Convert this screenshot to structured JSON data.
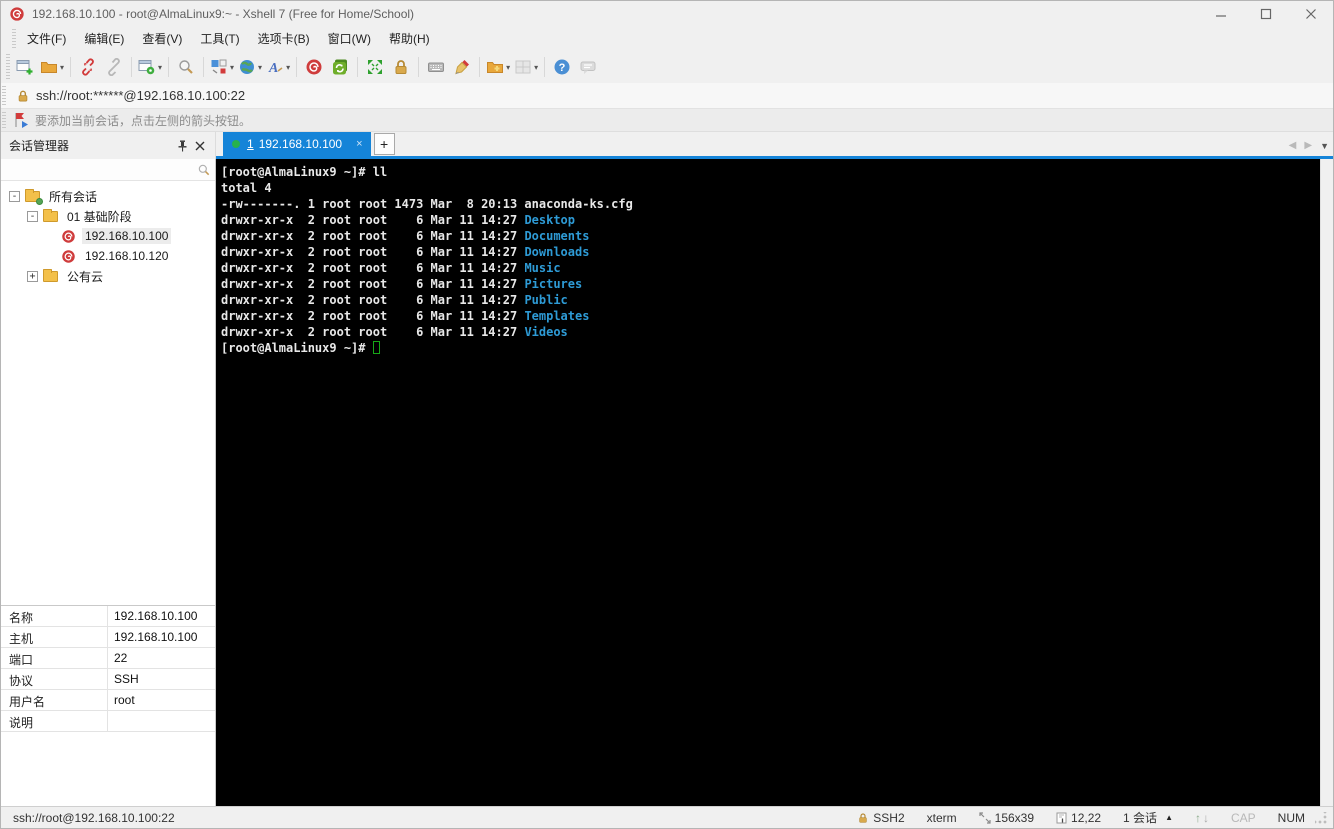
{
  "window": {
    "title": "192.168.10.100 - root@AlmaLinux9:~ - Xshell 7 (Free for Home/School)",
    "controls": {
      "minimize": "–",
      "maximize": "□",
      "close": "×"
    }
  },
  "menu": {
    "items": [
      "文件(F)",
      "编辑(E)",
      "查看(V)",
      "工具(T)",
      "选项卡(B)",
      "窗口(W)",
      "帮助(H)"
    ]
  },
  "toolbar": {
    "icons": [
      "new-session",
      "open-folder",
      "disconnect",
      "reconnect",
      "session-properties",
      "find",
      "layout",
      "web",
      "font",
      "xshell",
      "xftp",
      "fullscreen",
      "lock",
      "virtual-keyboard",
      "highlight-pen",
      "new-session-folder",
      "tile-view",
      "help",
      "feedback"
    ]
  },
  "address_bar": {
    "value": "ssh://root:******@192.168.10.100:22"
  },
  "notice_bar": {
    "text": "要添加当前会话，点击左侧的箭头按钮。"
  },
  "session_manager": {
    "title": "会话管理器",
    "search_value": "",
    "tree": [
      {
        "label": "所有会话",
        "level": 0,
        "expander": "-",
        "icon": "folder-all-sessions",
        "selected": false
      },
      {
        "label": "01 基础阶段",
        "level": 1,
        "expander": "-",
        "icon": "folder",
        "selected": false
      },
      {
        "label": "192.168.10.100",
        "level": 2,
        "expander": "",
        "icon": "session",
        "selected": true
      },
      {
        "label": "192.168.10.120",
        "level": 2,
        "expander": "",
        "icon": "session",
        "selected": false
      },
      {
        "label": "公有云",
        "level": 1,
        "expander": "+",
        "icon": "folder",
        "selected": false
      }
    ]
  },
  "tab_bar": {
    "active_tab": {
      "number": "1",
      "label": "192.168.10.100",
      "close": "×"
    },
    "new_tab_label": "+"
  },
  "terminal": {
    "colors": {
      "background": "#000000",
      "foreground": "#e8e8e8",
      "directory": "#2e9bd6",
      "cursor": "#17a817"
    },
    "lines": [
      [
        {
          "t": "[root@AlmaLinux9 ~]# ll"
        }
      ],
      [
        {
          "t": "total 4"
        }
      ],
      [
        {
          "t": "-rw-------. 1 root root 1473 Mar  8 20:13 anaconda-ks.cfg"
        }
      ],
      [
        {
          "t": "drwxr-xr-x  2 root root    6 Mar 11 14:27 "
        },
        {
          "t": "Desktop",
          "c": "dir"
        }
      ],
      [
        {
          "t": "drwxr-xr-x  2 root root    6 Mar 11 14:27 "
        },
        {
          "t": "Documents",
          "c": "dir"
        }
      ],
      [
        {
          "t": "drwxr-xr-x  2 root root    6 Mar 11 14:27 "
        },
        {
          "t": "Downloads",
          "c": "dir"
        }
      ],
      [
        {
          "t": "drwxr-xr-x  2 root root    6 Mar 11 14:27 "
        },
        {
          "t": "Music",
          "c": "dir"
        }
      ],
      [
        {
          "t": "drwxr-xr-x  2 root root    6 Mar 11 14:27 "
        },
        {
          "t": "Pictures",
          "c": "dir"
        }
      ],
      [
        {
          "t": "drwxr-xr-x  2 root root    6 Mar 11 14:27 "
        },
        {
          "t": "Public",
          "c": "dir"
        }
      ],
      [
        {
          "t": "drwxr-xr-x  2 root root    6 Mar 11 14:27 "
        },
        {
          "t": "Templates",
          "c": "dir"
        }
      ],
      [
        {
          "t": "drwxr-xr-x  2 root root    6 Mar 11 14:27 "
        },
        {
          "t": "Videos",
          "c": "dir"
        }
      ],
      [
        {
          "t": "[root@AlmaLinux9 ~]# "
        },
        {
          "t": " ",
          "c": "cursor"
        }
      ]
    ]
  },
  "properties_panel": {
    "rows": [
      {
        "label": "名称",
        "value": "192.168.10.100"
      },
      {
        "label": "主机",
        "value": "192.168.10.100"
      },
      {
        "label": "端口",
        "value": "22"
      },
      {
        "label": "协议",
        "value": "SSH"
      },
      {
        "label": "用户名",
        "value": "root"
      },
      {
        "label": "说明",
        "value": ""
      }
    ]
  },
  "status_bar": {
    "left": "ssh://root@192.168.10.100:22",
    "protocol": "SSH2",
    "terminal_type": "xterm",
    "size": "156x39",
    "cursor_position": "12,22",
    "session_count": "1 会话",
    "cap": "CAP",
    "num": "NUM"
  }
}
